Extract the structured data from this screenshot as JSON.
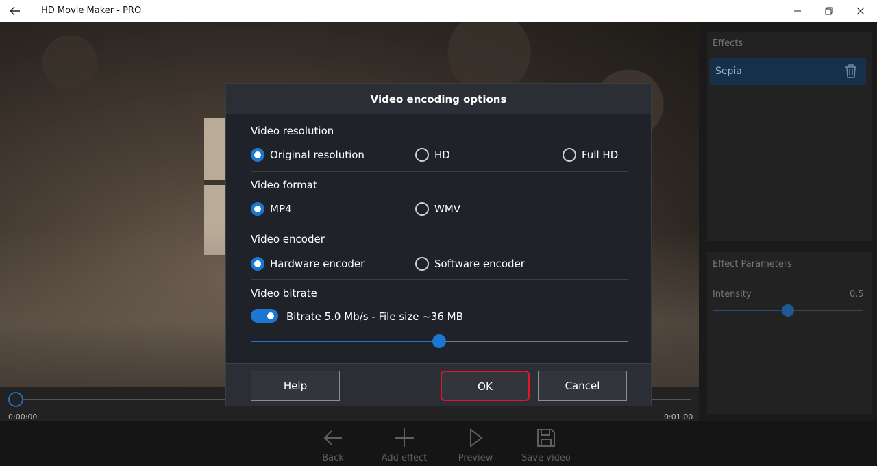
{
  "window": {
    "title": "HD Movie Maker - PRO"
  },
  "timeline": {
    "start_time": "0:00:00",
    "end_time": "0:01:00"
  },
  "effects_panel": {
    "header": "Effects",
    "items": [
      {
        "label": "Sepia"
      }
    ]
  },
  "params_panel": {
    "header": "Effect Parameters",
    "param_label": "Intensity",
    "param_value": "0.5",
    "param_level": 0.5
  },
  "toolbar": {
    "back_label": "Back",
    "add_effect_label": "Add effect",
    "preview_label": "Preview",
    "save_video_label": "Save video"
  },
  "dialog": {
    "title": "Video encoding options",
    "resolution": {
      "title": "Video resolution",
      "options": [
        "Original resolution",
        "HD",
        "Full HD"
      ],
      "selected": "Original resolution"
    },
    "format": {
      "title": "Video format",
      "options": [
        "MP4",
        "WMV"
      ],
      "selected": "MP4"
    },
    "encoder": {
      "title": "Video encoder",
      "options": [
        "Hardware encoder",
        "Software encoder"
      ],
      "selected": "Hardware encoder"
    },
    "bitrate": {
      "title": "Video bitrate",
      "toggle_on": true,
      "label": "Bitrate 5.0 Mb/s - File size ~36 MB",
      "slider_level": 0.5
    },
    "buttons": {
      "help": "Help",
      "ok": "OK",
      "cancel": "Cancel"
    }
  },
  "colors": {
    "accent": "#1a78d4",
    "highlight_border": "#e3142b"
  }
}
